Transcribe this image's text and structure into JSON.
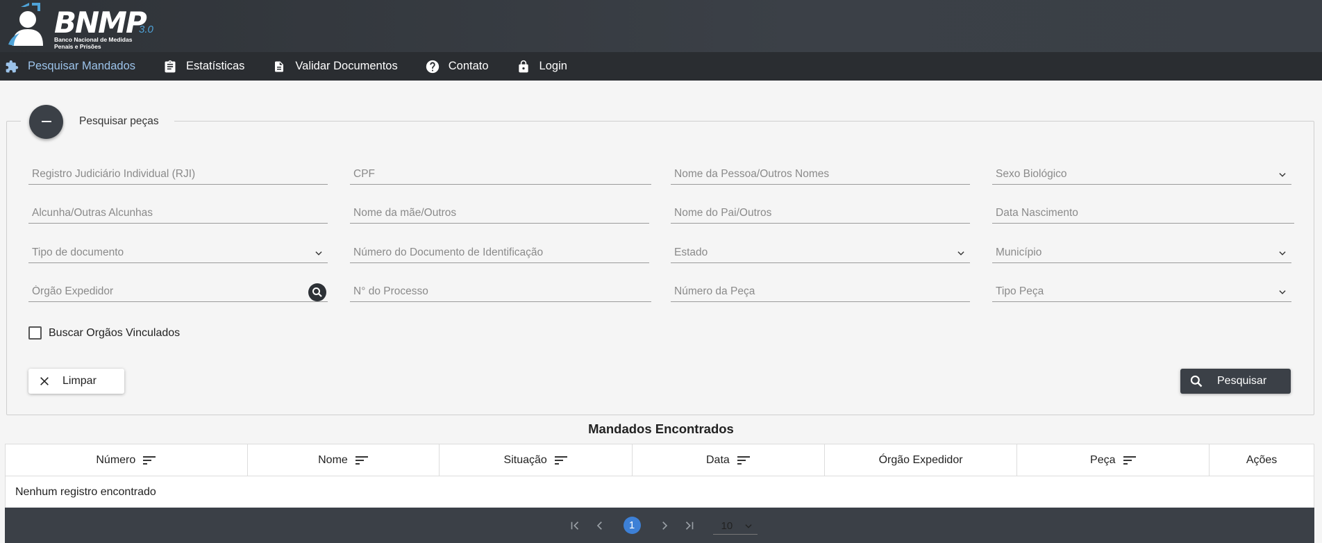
{
  "brand": {
    "logo_text": "BNMP",
    "version": "3.0",
    "subtitle": "Banco Nacional de Medidas Penais e Prisões"
  },
  "nav": [
    {
      "label": "Pesquisar Mandados",
      "icon": "puzzle-icon",
      "active": true
    },
    {
      "label": "Estatísticas",
      "icon": "clipboard-icon",
      "active": false
    },
    {
      "label": "Validar Documentos",
      "icon": "document-icon",
      "active": false
    },
    {
      "label": "Contato",
      "icon": "help-circle-icon",
      "active": false
    },
    {
      "label": "Login",
      "icon": "lock-icon",
      "active": false
    }
  ],
  "search": {
    "legend": "Pesquisar peças",
    "fields": {
      "rji": {
        "placeholder": "Registro Judiciário Individual (RJI)",
        "value": ""
      },
      "cpf": {
        "placeholder": "CPF",
        "value": ""
      },
      "nome": {
        "placeholder": "Nome da Pessoa/Outros Nomes",
        "value": ""
      },
      "sexo": {
        "placeholder": "Sexo Biológico",
        "value": ""
      },
      "alcunha": {
        "placeholder": "Alcunha/Outras Alcunhas",
        "value": ""
      },
      "mae": {
        "placeholder": "Nome da mãe/Outros",
        "value": ""
      },
      "pai": {
        "placeholder": "Nome do Pai/Outros",
        "value": ""
      },
      "nascimento": {
        "placeholder": "Data Nascimento",
        "value": ""
      },
      "tipo_documento": {
        "placeholder": "Tipo de documento",
        "value": ""
      },
      "numero_documento": {
        "placeholder": "Número do Documento de Identificação",
        "value": ""
      },
      "estado": {
        "placeholder": "Estado",
        "value": ""
      },
      "municipio": {
        "placeholder": "Município",
        "value": ""
      },
      "orgao": {
        "placeholder": "Órgão Expedidor",
        "value": ""
      },
      "processo": {
        "placeholder": "N° do Processo",
        "value": ""
      },
      "numero_peca": {
        "placeholder": "Número da Peça",
        "value": ""
      },
      "tipo_peca": {
        "placeholder": "Tipo Peça",
        "value": ""
      }
    },
    "checkbox_label": "Buscar Orgãos Vinculados",
    "clear_label": "Limpar",
    "search_label": "Pesquisar"
  },
  "results": {
    "title": "Mandados Encontrados",
    "columns": [
      "Número",
      "Nome",
      "Situação",
      "Data",
      "Órgão Expedidor",
      "Peça",
      "Ações"
    ],
    "empty_message": "Nenhum registro encontrado"
  },
  "pagination": {
    "current_page": "1",
    "page_size": "10"
  },
  "colors": {
    "header_bg": "#3b4047",
    "nav_bg": "#2a2d31",
    "active_nav": "#9cc3ea",
    "accent": "#3d80d6"
  }
}
